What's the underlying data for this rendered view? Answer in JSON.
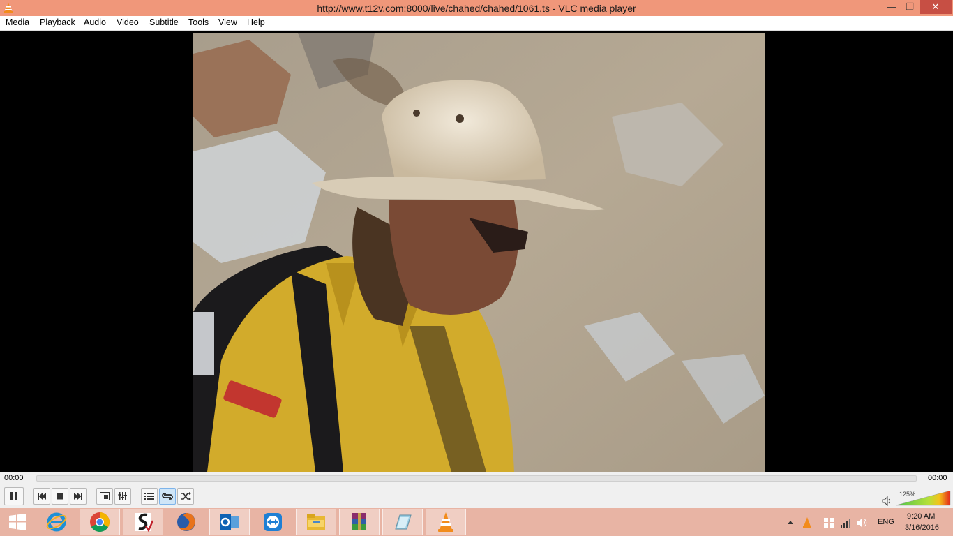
{
  "window": {
    "title": "http://www.t12v.com:8000/live/chahed/chahed/1061.ts - VLC media player",
    "controls": {
      "minimize": "—",
      "maximize": "❐",
      "close": "✕"
    }
  },
  "menu": {
    "items": [
      "Media",
      "Playback",
      "Audio",
      "Video",
      "Subtitle",
      "Tools",
      "View",
      "Help"
    ]
  },
  "player": {
    "elapsed": "00:00",
    "remaining": "00:00",
    "position": 0,
    "volume_label": "125%",
    "volume": 1.25
  },
  "icons": {
    "pause": "pause-icon",
    "prev": "skip-previous-icon",
    "stop": "stop-icon",
    "next": "skip-next-icon",
    "fullscreen": "fullscreen-icon",
    "ext": "extended-settings-icon",
    "playlist": "playlist-icon",
    "loop": "loop-icon",
    "shuffle": "shuffle-icon",
    "speaker": "speaker-icon"
  },
  "taskbar": {
    "apps": [
      "start",
      "internet-explorer",
      "chrome",
      "app-s",
      "firefox",
      "outlook",
      "teamviewer",
      "file-explorer",
      "winrar",
      "app-sheet",
      "vlc"
    ],
    "language": "ENG",
    "time": "9:20 AM",
    "date": "3/16/2016"
  },
  "colors": {
    "titlebar": "#f0977a",
    "close": "#c74f44",
    "taskbar": "#e8b4a4"
  }
}
